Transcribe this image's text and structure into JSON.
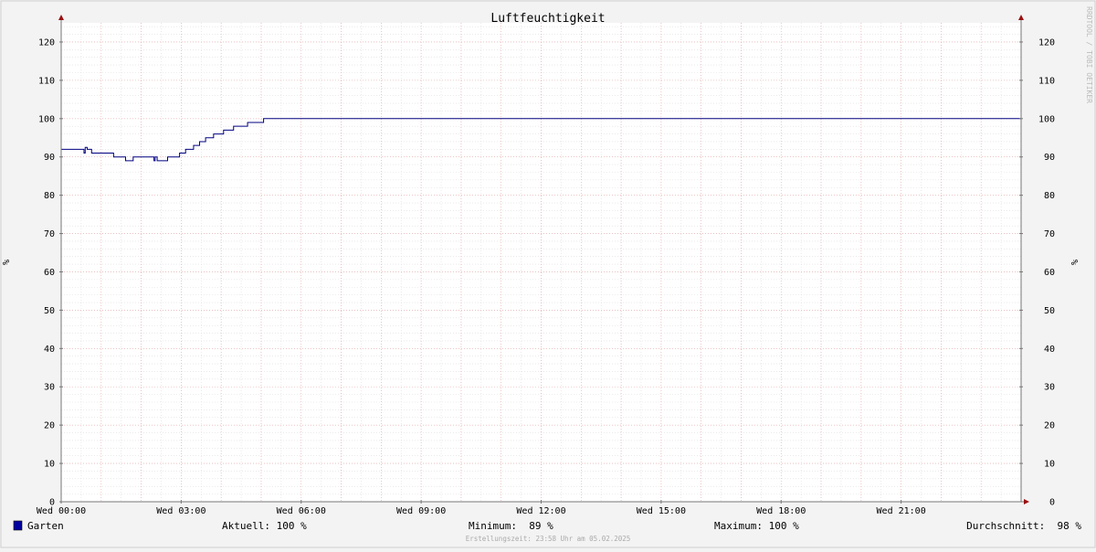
{
  "chart_data": {
    "type": "line",
    "title": "Luftfeuchtigkeit",
    "ylabel": "%",
    "ylim": [
      0,
      125
    ],
    "y_ticks": [
      0,
      10,
      20,
      30,
      40,
      50,
      60,
      70,
      80,
      90,
      100,
      110,
      120
    ],
    "x_domain_hours": [
      0,
      24
    ],
    "x_ticks": [
      {
        "hour": 0,
        "label": "Wed 00:00"
      },
      {
        "hour": 3,
        "label": "Wed 03:00"
      },
      {
        "hour": 6,
        "label": "Wed 06:00"
      },
      {
        "hour": 9,
        "label": "Wed 09:00"
      },
      {
        "hour": 12,
        "label": "Wed 12:00"
      },
      {
        "hour": 15,
        "label": "Wed 15:00"
      },
      {
        "hour": 18,
        "label": "Wed 18:00"
      },
      {
        "hour": 21,
        "label": "Wed 21:00"
      }
    ],
    "grid": true,
    "legend_position": "bottom-left",
    "series": [
      {
        "name": "Garten",
        "color": "#000080",
        "legend_color": "#0000a0",
        "points": [
          [
            0.0,
            92
          ],
          [
            0.55,
            92
          ],
          [
            0.57,
            91
          ],
          [
            0.6,
            92.5
          ],
          [
            0.65,
            92
          ],
          [
            0.75,
            92
          ],
          [
            0.76,
            91
          ],
          [
            1.3,
            91
          ],
          [
            1.31,
            90
          ],
          [
            1.6,
            90
          ],
          [
            1.61,
            89
          ],
          [
            1.78,
            89
          ],
          [
            1.8,
            90
          ],
          [
            2.3,
            90
          ],
          [
            2.32,
            89
          ],
          [
            2.35,
            90
          ],
          [
            2.4,
            89
          ],
          [
            2.65,
            89
          ],
          [
            2.66,
            90
          ],
          [
            2.95,
            90
          ],
          [
            2.96,
            91
          ],
          [
            3.1,
            91
          ],
          [
            3.11,
            92
          ],
          [
            3.3,
            92
          ],
          [
            3.31,
            93
          ],
          [
            3.45,
            93
          ],
          [
            3.46,
            94
          ],
          [
            3.6,
            94
          ],
          [
            3.61,
            95
          ],
          [
            3.8,
            95
          ],
          [
            3.81,
            96
          ],
          [
            4.05,
            96
          ],
          [
            4.06,
            97
          ],
          [
            4.3,
            97
          ],
          [
            4.31,
            98
          ],
          [
            4.65,
            98
          ],
          [
            4.66,
            99
          ],
          [
            5.05,
            99
          ],
          [
            5.06,
            100
          ],
          [
            24.0,
            100
          ]
        ]
      }
    ],
    "legend_stats": [
      {
        "label": "Aktuell:",
        "value": "100 %"
      },
      {
        "label": "Minimum:",
        "value": " 89 %"
      },
      {
        "label": "Maximum:",
        "value": "100 %"
      },
      {
        "label": "Durchschnitt:",
        "value": " 98 %"
      }
    ],
    "watermark": "RRDTOOL / TOBI OETIKER",
    "footer": "Erstellungszeit: 23:58 Uhr am 05.02.2025"
  }
}
